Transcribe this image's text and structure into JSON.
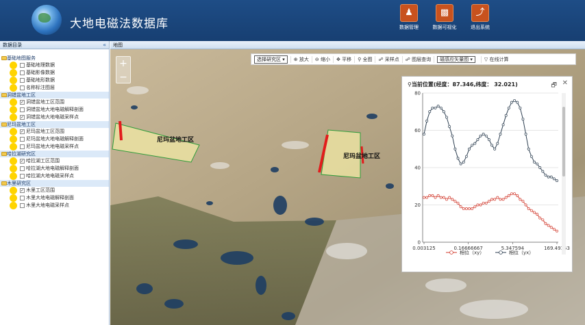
{
  "header": {
    "title": "大地电磁法数据库",
    "buttons": [
      {
        "label": "数据管理",
        "icon": "user-icon"
      },
      {
        "label": "数据可视化",
        "icon": "chart-icon"
      },
      {
        "label": "退出系统",
        "icon": "run-icon"
      }
    ]
  },
  "sidebar": {
    "title": "数据目录",
    "collapse": "«",
    "groups": [
      {
        "label": "基础地图服务",
        "items": [
          {
            "label": "基础地理数据",
            "checked": false
          },
          {
            "label": "基础影像数据",
            "checked": false
          },
          {
            "label": "基础地形数据",
            "checked": false
          },
          {
            "label": "名称标注图层",
            "checked": false
          }
        ]
      },
      {
        "label": "洞错盆地工区",
        "items": [
          {
            "label": "洞错盆地工区范围",
            "checked": true
          },
          {
            "label": "洞错盆地大地电磁解释剖面",
            "checked": false
          },
          {
            "label": "洞错盆地大地电磁采样点",
            "checked": true
          }
        ]
      },
      {
        "label": "尼玛盆地工区",
        "items": [
          {
            "label": "尼玛盆地工区范围",
            "checked": true
          },
          {
            "label": "尼玛盆地大地电磁解释剖面",
            "checked": false
          },
          {
            "label": "尼玛盆地大地电磁采样点",
            "checked": false
          }
        ]
      },
      {
        "label": "哈拉湖研究区",
        "items": [
          {
            "label": "哈拉湖工区范围",
            "checked": true
          },
          {
            "label": "哈拉湖大地电磁解释剖面",
            "checked": false
          },
          {
            "label": "哈拉湖大地电磁采样点",
            "checked": false
          }
        ]
      },
      {
        "label": "木里研究区",
        "items": [
          {
            "label": "木里工区范围",
            "checked": true
          },
          {
            "label": "木里大地电磁解释剖面",
            "checked": false
          },
          {
            "label": "木里大地电磁采样点",
            "checked": false
          }
        ]
      }
    ]
  },
  "map": {
    "title": "地图",
    "zoom_in": "+",
    "zoom_out": "−",
    "labels": [
      "尼玛盆地工区",
      "尼玛盆地工区"
    ],
    "toolbar": {
      "select_area": "选择研究区",
      "zoom_in": "放大",
      "zoom_out": "缩小",
      "pan": "平移",
      "full": "全图",
      "sample": "采样点",
      "query": "图层查询",
      "layer_select": "磁感应矢量图",
      "online": "在线计算"
    }
  },
  "chart_panel": {
    "title": "当前位置(经度：87.346,纬度： 32.021)",
    "restore": "🗗",
    "close": "✕"
  },
  "chart_data": {
    "type": "line",
    "title": "",
    "xlabel": "",
    "ylabel": "",
    "ylim": [
      0,
      80
    ],
    "yticks": [
      "0",
      "20",
      "40",
      "60",
      "80"
    ],
    "xticks": [
      "0.003125",
      "0.16666667",
      "5.347594",
      "169.49153"
    ],
    "legend_position": "bottom",
    "series": [
      {
        "name": "相位（xy）",
        "color": "#d23b2e",
        "values": [
          24,
          24,
          25,
          25,
          24,
          25,
          24,
          24,
          23,
          24,
          23,
          22,
          21,
          19,
          18,
          18,
          18,
          18,
          19,
          20,
          20,
          21,
          21,
          22,
          23,
          23,
          24,
          23,
          23,
          24,
          25,
          26,
          26,
          25,
          23,
          22,
          20,
          18,
          17,
          16,
          15,
          13,
          12,
          10,
          9,
          8,
          7,
          6
        ]
      },
      {
        "name": "相位（yx）",
        "color": "#2c3e50",
        "values": [
          58,
          65,
          70,
          72,
          72,
          73,
          72,
          70,
          67,
          62,
          57,
          50,
          45,
          42,
          43,
          46,
          50,
          52,
          53,
          55,
          57,
          58,
          57,
          55,
          52,
          50,
          53,
          58,
          63,
          68,
          72,
          75,
          76,
          75,
          72,
          66,
          58,
          50,
          46,
          43,
          42,
          40,
          38,
          36,
          35,
          35,
          34,
          33
        ]
      }
    ]
  }
}
